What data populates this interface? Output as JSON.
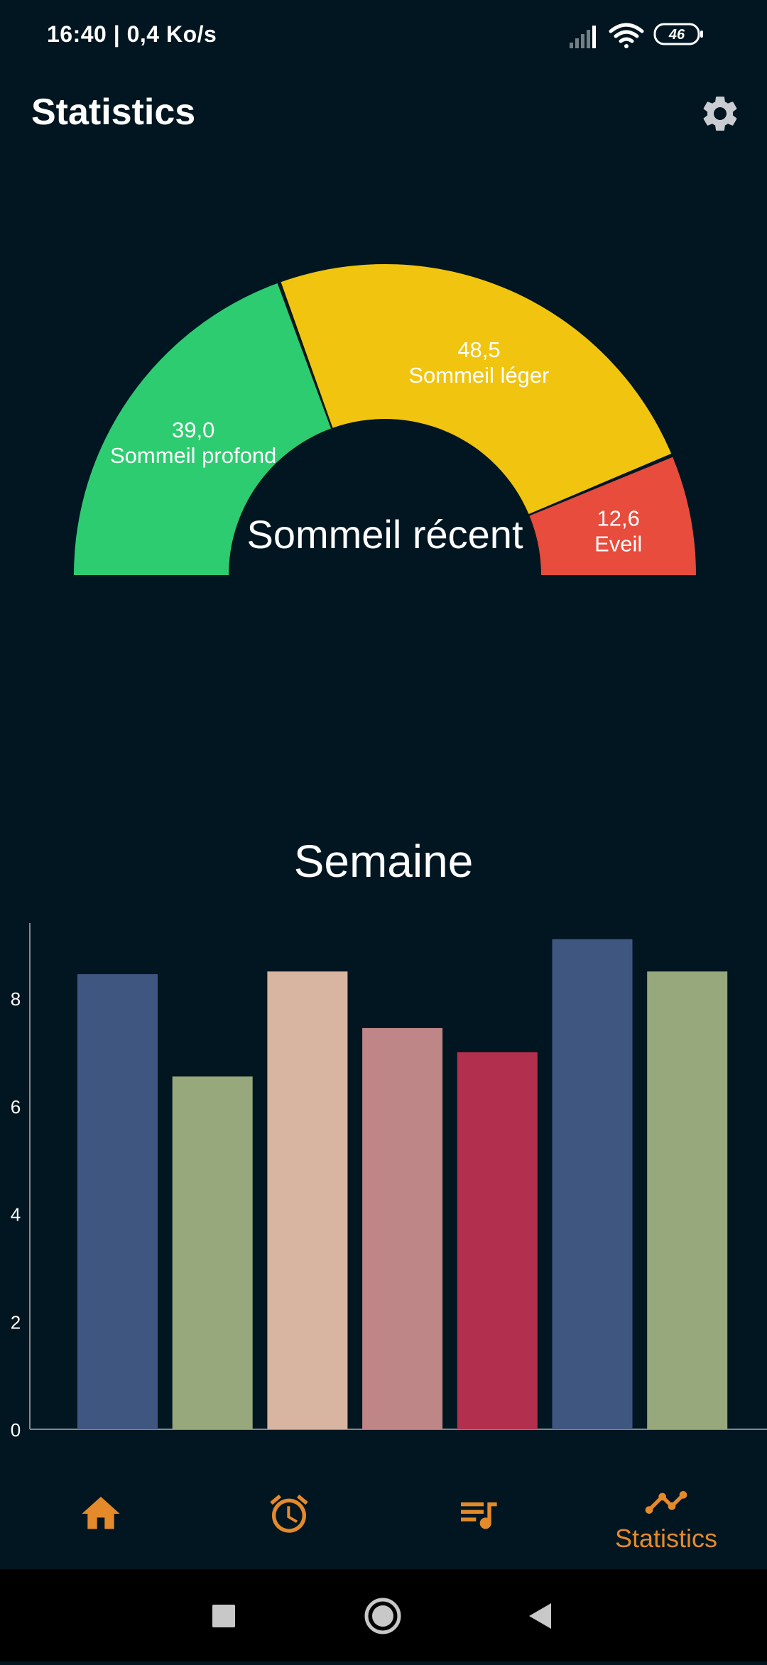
{
  "status_bar": {
    "time_speed": "16:40 | 0,4 Ko/s",
    "battery": "46",
    "icons": [
      "signal-icon",
      "wifi-icon",
      "battery-icon"
    ]
  },
  "header": {
    "title": "Statistics",
    "settings_icon": "gear-icon"
  },
  "gauge": {
    "center_label": "Sommeil récent",
    "segments": [
      {
        "value": "39,0",
        "label": "Sommeil profond",
        "color": "#2ECC71"
      },
      {
        "value": "48,5",
        "label": "Sommeil léger",
        "color": "#F1C40F"
      },
      {
        "value": "12,6",
        "label": "Eveil",
        "color": "#E74C3C"
      }
    ]
  },
  "week": {
    "title": "Semaine"
  },
  "chart_data": {
    "type": "bar",
    "title": "Semaine",
    "xlabel": "",
    "ylabel": "",
    "ylim": [
      0,
      9.4
    ],
    "yticks": [
      0,
      2,
      4,
      6,
      8
    ],
    "ytick_labels": [
      "0",
      "2",
      "4",
      "6",
      "8"
    ],
    "values": [
      8.45,
      6.55,
      8.5,
      7.45,
      7.0,
      9.1,
      8.5
    ],
    "colors": [
      "#3F5780",
      "#97A87D",
      "#D8B5A0",
      "#BE8686",
      "#B2304D",
      "#3F5780",
      "#97A87D"
    ],
    "grid": false,
    "legend": "none"
  },
  "bottom_nav": {
    "accent_color": "#E58A2B",
    "items": [
      {
        "icon": "home-icon",
        "label": ""
      },
      {
        "icon": "alarm-icon",
        "label": ""
      },
      {
        "icon": "playlist-icon",
        "label": ""
      },
      {
        "icon": "statistics-icon",
        "label": "Statistics"
      }
    ]
  },
  "system_nav": {
    "icons": [
      "recents-icon",
      "home-circle-icon",
      "back-icon"
    ]
  }
}
